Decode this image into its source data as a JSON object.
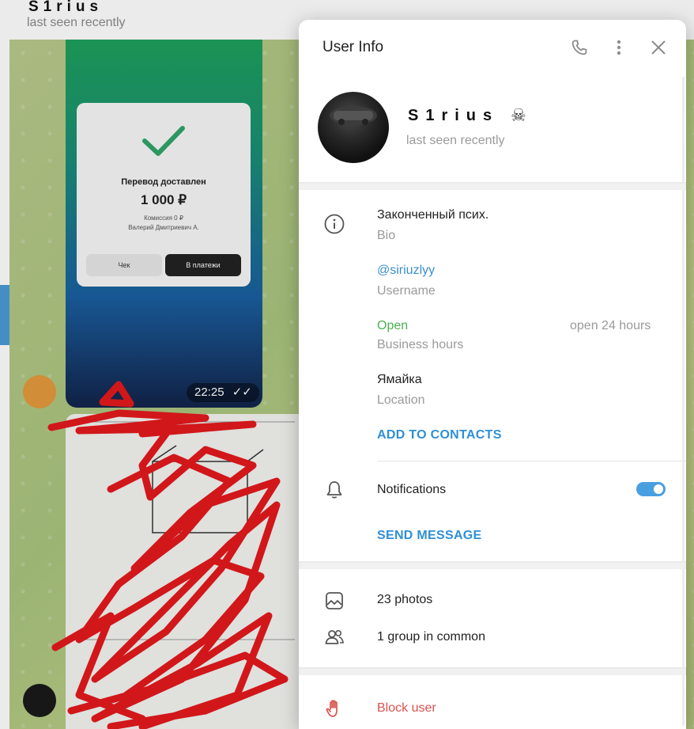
{
  "chat": {
    "name": "S1rius",
    "status": "last seen recently",
    "receipt": {
      "title": "Перевод доставлен",
      "amount": "1 000 ₽",
      "fee": "Комиссия 0 ₽",
      "recipient": "Валерий Дмитриевич А.",
      "btn_check": "Чек",
      "btn_payments": "В платежи"
    },
    "message_time": "22:25"
  },
  "panel": {
    "title": "User Info",
    "profile": {
      "name": "S1rius",
      "status": "last seen recently"
    },
    "info": {
      "bio_value": "Законченный псих.",
      "bio_label": "Bio",
      "username_value": "@siriuzlyy",
      "username_label": "Username",
      "hours_status": "Open",
      "hours_detail": "open 24 hours",
      "hours_label": "Business hours",
      "location_value": "Ямайка",
      "location_label": "Location",
      "add_contacts": "ADD TO CONTACTS"
    },
    "notifications": {
      "label": "Notifications",
      "enabled": true,
      "send_message": "SEND MESSAGE"
    },
    "media": {
      "photos": "23 photos",
      "groups": "1 group in common"
    },
    "block": {
      "label": "Block user"
    }
  },
  "colors": {
    "accent": "#2f8fd6",
    "open_green": "#4caf50",
    "danger": "#d9534f"
  },
  "icons": [
    "phone-icon",
    "more-vertical-icon",
    "close-icon",
    "info-icon",
    "bell-icon",
    "photo-icon",
    "group-icon",
    "hand-stop-icon"
  ]
}
